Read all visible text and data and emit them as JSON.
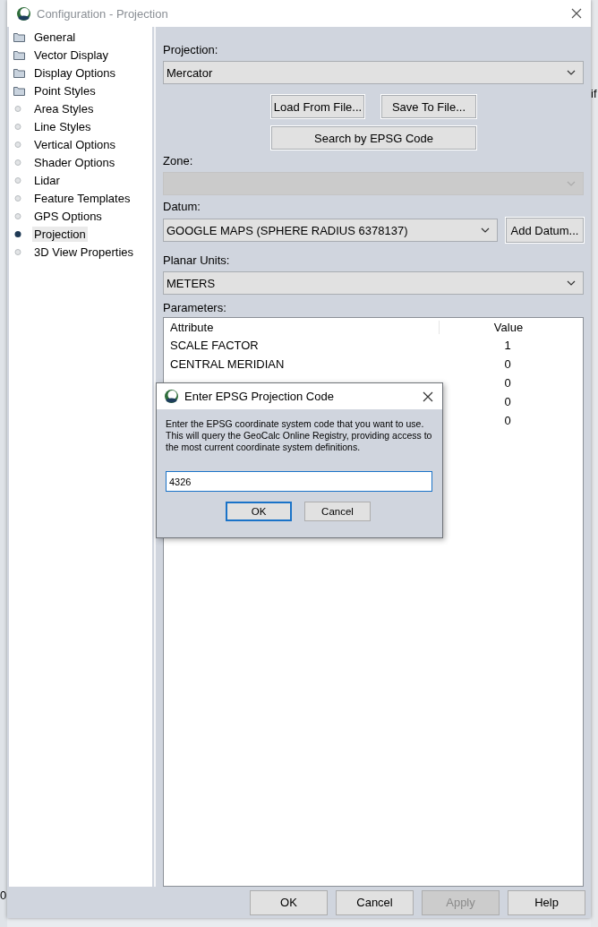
{
  "window": {
    "title": "Configuration - Projection"
  },
  "background_app": {
    "texts": [
      "if",
      "0"
    ]
  },
  "sidebar": {
    "items": [
      {
        "label": "General",
        "kind": "folder",
        "selected": false
      },
      {
        "label": "Vector Display",
        "kind": "folder",
        "selected": false
      },
      {
        "label": "Display Options",
        "kind": "folder",
        "selected": false
      },
      {
        "label": "Point Styles",
        "kind": "folder",
        "selected": false
      },
      {
        "label": "Area Styles",
        "kind": "page",
        "selected": false
      },
      {
        "label": "Line Styles",
        "kind": "page",
        "selected": false
      },
      {
        "label": "Vertical Options",
        "kind": "page",
        "selected": false
      },
      {
        "label": "Shader Options",
        "kind": "page",
        "selected": false
      },
      {
        "label": "Lidar",
        "kind": "page",
        "selected": false
      },
      {
        "label": "Feature Templates",
        "kind": "page",
        "selected": false
      },
      {
        "label": "GPS Options",
        "kind": "page",
        "selected": false
      },
      {
        "label": "Projection",
        "kind": "page",
        "selected": true
      },
      {
        "label": "3D View Properties",
        "kind": "page",
        "selected": false
      }
    ]
  },
  "projection": {
    "label": "Projection:",
    "value": "Mercator"
  },
  "file_buttons": [
    "Load From File...",
    "Save To File..."
  ],
  "search_button": "Search by EPSG Code",
  "zone": {
    "label": "Zone:",
    "disabled": true
  },
  "datum": {
    "label": "Datum:",
    "value": "GOOGLE MAPS (SPHERE RADIUS 6378137)",
    "button": "Add Datum..."
  },
  "planar_units": {
    "label": "Planar Units:",
    "value": "METERS"
  },
  "parameters": {
    "label": "Parameters:",
    "columns": [
      "Attribute",
      "Value"
    ],
    "rows": [
      {
        "attribute": "SCALE FACTOR",
        "value": "1"
      },
      {
        "attribute": "CENTRAL MERIDIAN",
        "value": "0"
      },
      {
        "value": "0"
      },
      {
        "value": "0"
      },
      {
        "value": "0"
      }
    ]
  },
  "buttons": [
    {
      "label": "OK",
      "disabled": false
    },
    {
      "label": "Cancel",
      "disabled": false
    },
    {
      "label": "Apply",
      "disabled": true
    },
    {
      "label": "Help",
      "disabled": false
    }
  ],
  "dialog": {
    "title": "Enter EPSG Projection Code",
    "message": "Enter the EPSG coordinate system code that you want to use. This will query the GeoCalc Online Registry, providing access to the most current coordinate system definitions.",
    "value": "4326",
    "buttons": [
      {
        "label": "OK",
        "default": true
      },
      {
        "label": "Cancel",
        "default": false
      }
    ]
  }
}
